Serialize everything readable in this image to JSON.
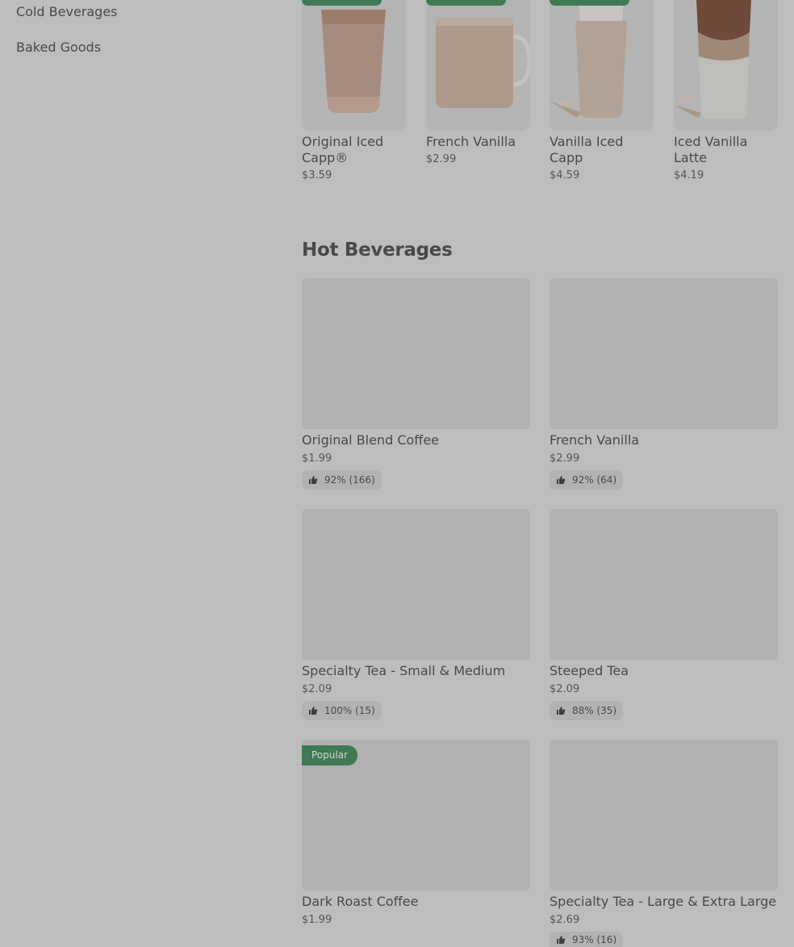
{
  "sidebar": {
    "items": [
      {
        "label": "Cold Beverages"
      },
      {
        "label": "Baked Goods"
      }
    ]
  },
  "cold_beverages": {
    "items": [
      {
        "name": "Original Iced Capp®",
        "price": "$3.59"
      },
      {
        "name": "French Vanilla",
        "price": "$2.99"
      },
      {
        "name": "Vanilla Iced Capp",
        "price": "$4.59"
      },
      {
        "name": "Iced Vanilla Latte",
        "price": "$4.19"
      }
    ]
  },
  "hot_beverages": {
    "title": "Hot Beverages",
    "items": [
      {
        "name": "Original Blend Coffee",
        "price": "$1.99",
        "rating": "92% (166)"
      },
      {
        "name": "French Vanilla",
        "price": "$2.99",
        "rating": "92% (64)"
      },
      {
        "name": "Specialty Tea - Small & Medium",
        "price": "$2.09",
        "rating": "100% (15)"
      },
      {
        "name": "Steeped Tea",
        "price": "$2.09",
        "rating": "88% (35)"
      },
      {
        "name": "Dark Roast Coffee",
        "price": "$1.99",
        "badge": "Popular"
      },
      {
        "name": "Specialty Tea - Large & Extra Large",
        "price": "$2.69",
        "rating": "93% (16)"
      }
    ]
  },
  "icons": {
    "rating": "thumbs-up-icon"
  },
  "colors": {
    "accent": "#3f7a55",
    "overlay_bg": "#bdbdbd"
  }
}
